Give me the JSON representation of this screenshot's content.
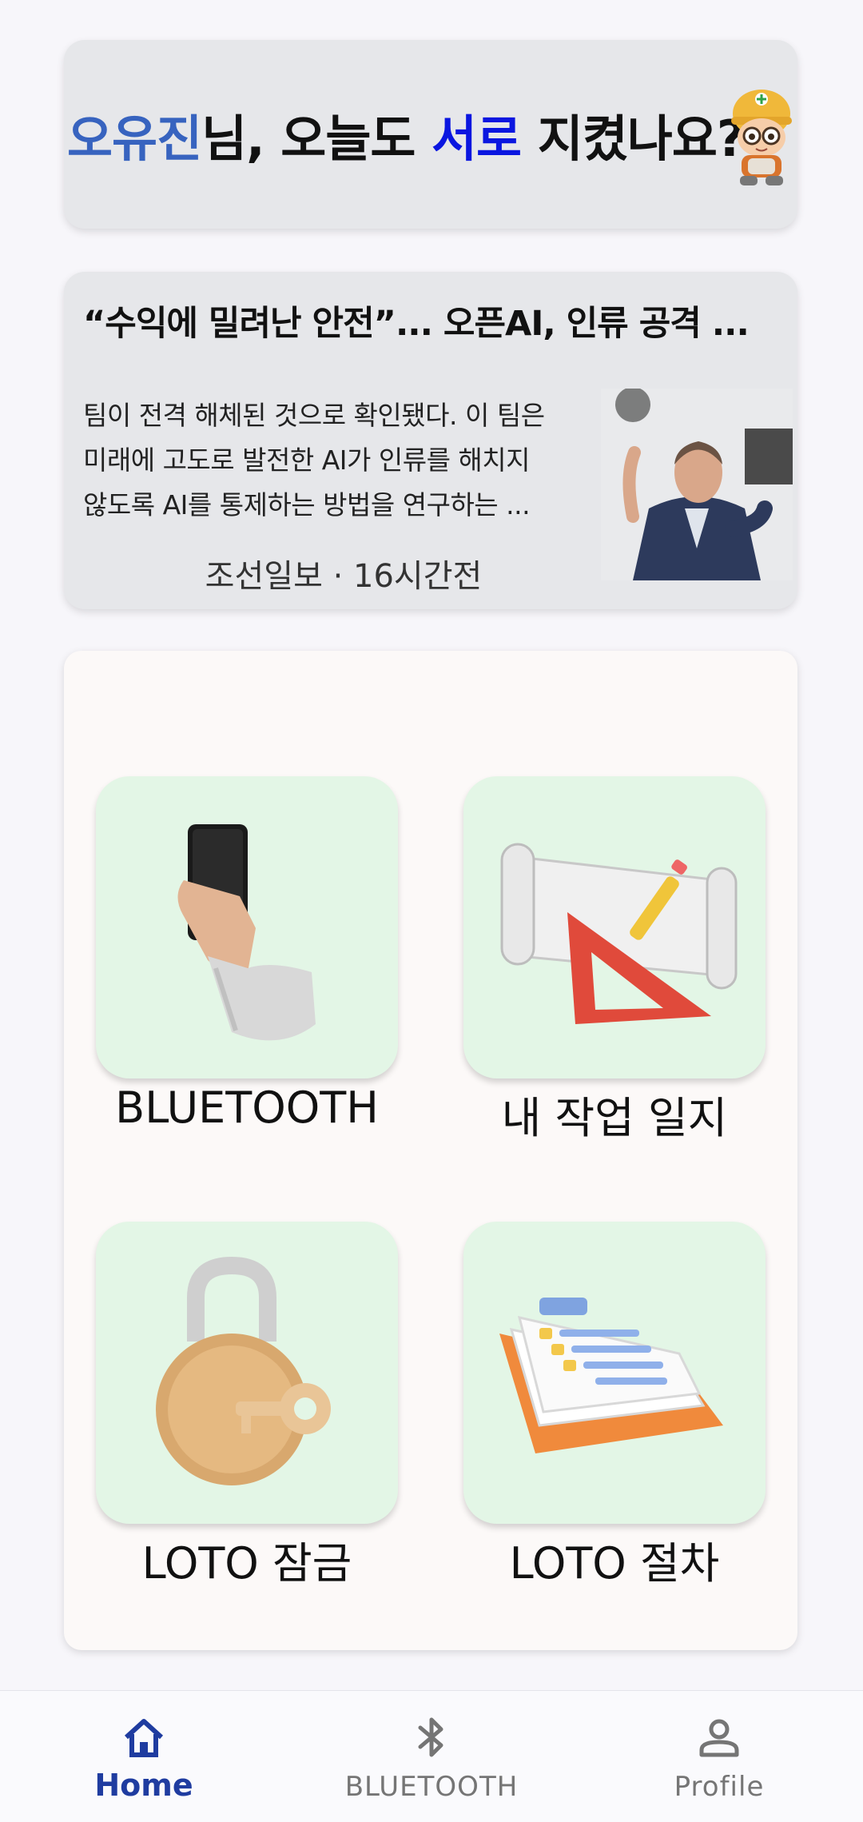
{
  "greeting": {
    "name": "오유진",
    "text_a": "님, 오늘도 ",
    "keyword": "서로",
    "text_b": " 지켰나요?",
    "mascot_icon": "worker-mascot-icon"
  },
  "news": {
    "title": "“수익에 밀려난 안전”... 오픈AI, 인류 공격 ...",
    "body_lines": [
      "팀이 전격 해체된 것으로 확인됐다. 이 팀은",
      "미래에 고도로 발전한 AI가 인류를 해치지",
      "않도록 AI를 통제하는 방법을 연구하는 ..."
    ],
    "source": "조선일보 · 16시간전"
  },
  "menu": {
    "items": [
      {
        "label": "BLUETOOTH",
        "icon": "hand-holding-phone-icon"
      },
      {
        "label": "내 작업 일지",
        "icon": "blueprint-ruler-icon"
      },
      {
        "label": "LOTO 잠금",
        "icon": "padlock-key-icon"
      },
      {
        "label": "LOTO 절차",
        "icon": "clipboard-documents-icon"
      }
    ]
  },
  "nav": {
    "items": [
      {
        "label": "Home",
        "icon": "home-icon",
        "active": true
      },
      {
        "label": "BLUETOOTH",
        "icon": "bluetooth-icon",
        "active": false
      },
      {
        "label": "Profile",
        "icon": "person-icon",
        "active": false
      }
    ]
  },
  "colors": {
    "name": "#3763bf",
    "keyword": "#0a16e0",
    "tile_bg": "#e3f6e6",
    "nav_active": "#1f3ca0",
    "nav_inactive": "#757575"
  }
}
